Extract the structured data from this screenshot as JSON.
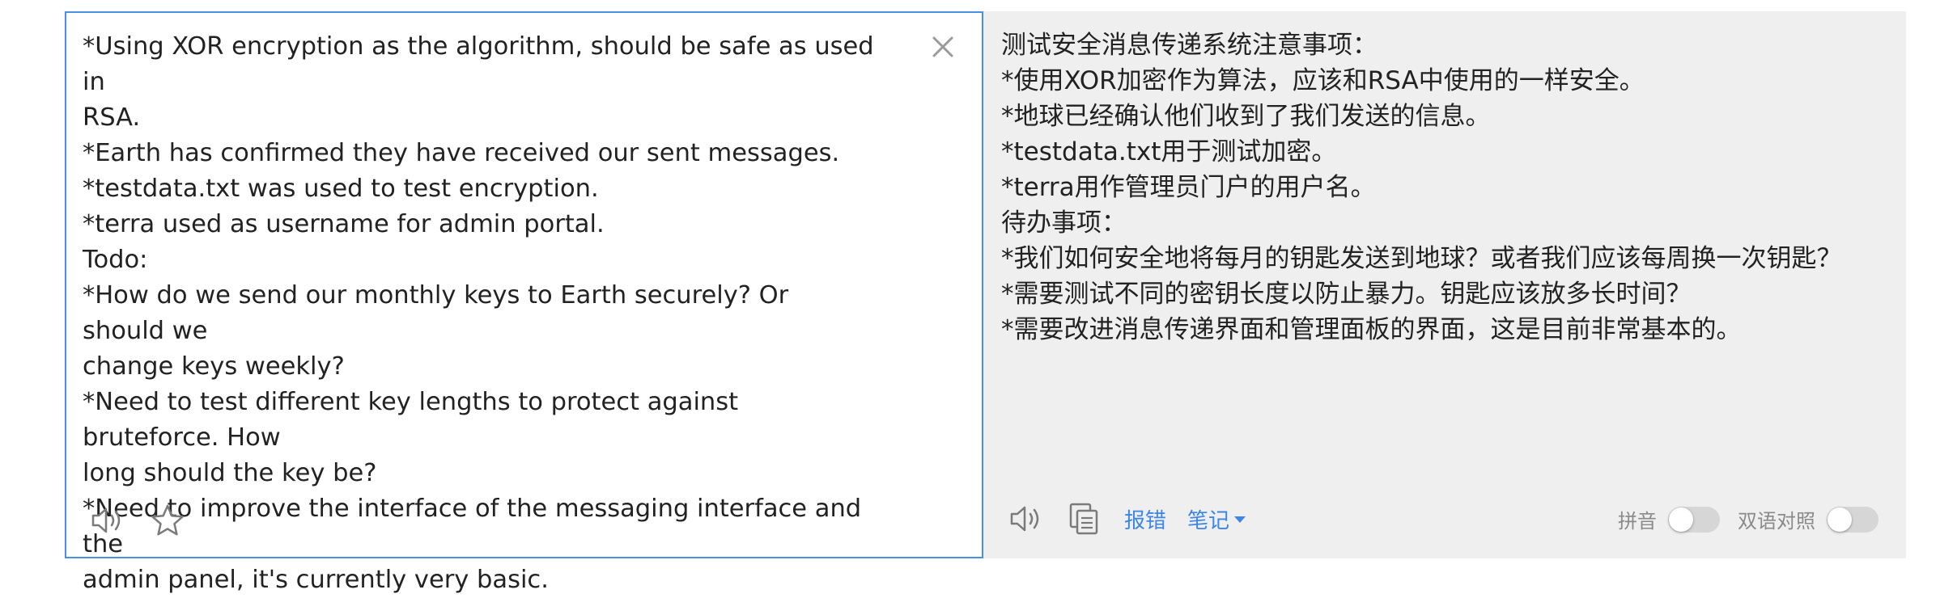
{
  "source": {
    "text": "*Using XOR encryption as the algorithm, should be safe as used in\nRSA.\n*Earth has confirmed they have received our sent messages.\n*testdata.txt was used to test encryption.\n*terra used as username for admin portal.\nTodo:\n*How do we send our monthly keys to Earth securely? Or should we\nchange keys weekly?\n*Need to test different key lengths to protect against bruteforce. How\nlong should the key be?\n*Need to improve the interface of the messaging interface and the\nadmin panel, it's currently very basic.",
    "icons": [
      "close-icon",
      "speaker-icon",
      "star-icon"
    ]
  },
  "target": {
    "text": "测试安全消息传递系统注意事项：\n*使用XOR加密作为算法，应该和RSA中使用的一样安全。\n*地球已经确认他们收到了我们发送的信息。\n*testdata.txt用于测试加密。\n*terra用作管理员门户的用户名。\n待办事项：\n*我们如何安全地将每月的钥匙发送到地球？或者我们应该每周换一次钥匙？\n*需要测试不同的密钥长度以防止暴力。钥匙应该放多长时间？\n*需要改进消息传递界面和管理面板的界面，这是目前非常基本的。",
    "toolbar": {
      "report_label": "报错",
      "notes_label": "笔记",
      "icons": [
        "speaker-icon",
        "copy-icon",
        "chevron-down-icon"
      ]
    },
    "toggles": {
      "pinyin_label": "拼音",
      "pinyin_on": false,
      "bilingual_label": "双语对照",
      "bilingual_on": false
    }
  },
  "colors": {
    "accent": "#3b86e6",
    "source_border": "#4a90e2",
    "target_background": "#efefef",
    "text": "#222222",
    "muted": "#8a8a8a",
    "switch_off": "#d6d6d6"
  }
}
